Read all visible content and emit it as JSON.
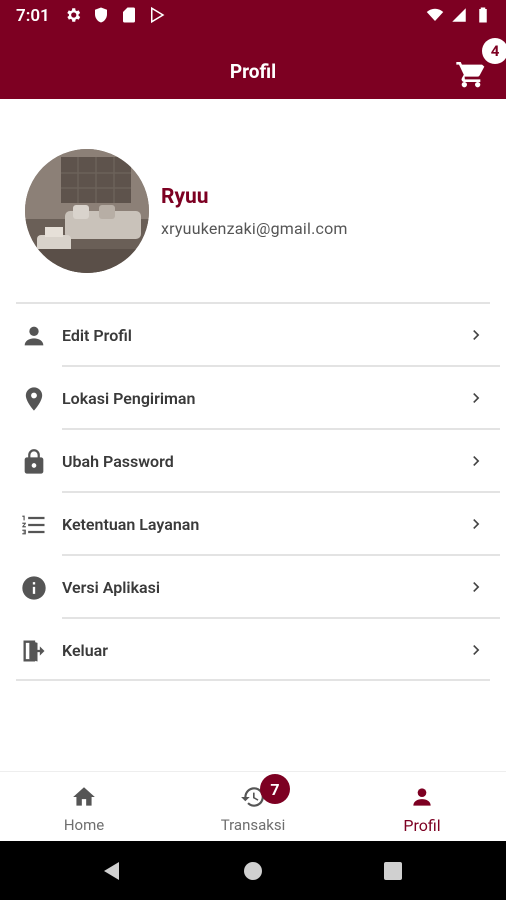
{
  "status_bar": {
    "time": "7:01"
  },
  "app_bar": {
    "title": "Profil",
    "cart_count": "4"
  },
  "profile": {
    "name": "Ryuu",
    "email": "xryuukenzaki@gmail.com"
  },
  "menu": [
    {
      "label": "Edit Profil",
      "icon": "person-icon"
    },
    {
      "label": "Lokasi Pengiriman",
      "icon": "location-pin-icon"
    },
    {
      "label": "Ubah Password",
      "icon": "lock-icon"
    },
    {
      "label": "Ketentuan Layanan",
      "icon": "list-numbered-icon"
    },
    {
      "label": "Versi Aplikasi",
      "icon": "info-icon"
    },
    {
      "label": "Keluar",
      "icon": "logout-icon"
    }
  ],
  "bottom_nav": {
    "items": [
      {
        "label": "Home",
        "icon": "home-icon"
      },
      {
        "label": "Transaksi",
        "icon": "history-icon",
        "badge": "7"
      },
      {
        "label": "Profil",
        "icon": "person-icon",
        "active": true
      }
    ]
  },
  "colors": {
    "primary": "#7d0022",
    "inactive": "#6e6e6e",
    "divider": "#e3e3e3"
  }
}
